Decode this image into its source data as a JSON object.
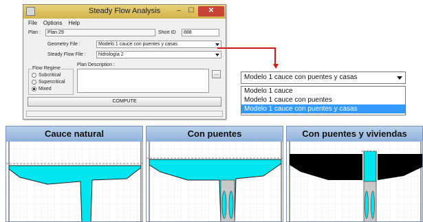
{
  "window": {
    "title": "Steady Flow Analysis",
    "minimize": "–",
    "maximize": "☐",
    "close": "✕"
  },
  "menu": [
    "File",
    "Options",
    "Help"
  ],
  "plan": {
    "label": "Plan :",
    "value": "Plan 29",
    "short_id_label": "Short ID",
    "short_id_value": "888"
  },
  "geometry": {
    "label": "Geometry File :",
    "value": "Modelo 1 cauce con puentes y casas"
  },
  "steady_flow": {
    "label": "Steady Flow File :",
    "value": "hidrología 2"
  },
  "flow_regime": {
    "label": "Flow Regime",
    "options": [
      "Subcritical",
      "Supercritical",
      "Mixed"
    ],
    "selected": "Mixed"
  },
  "plan_description": {
    "label": "Plan Description :",
    "value": "",
    "browse": "..."
  },
  "compute": {
    "label": "COMPUTE"
  },
  "callout": {
    "selected": "Modelo 1 cauce con puentes y casas",
    "options": [
      "Modelo 1 cauce",
      "Modelo 1 cauce con puentes",
      "Modelo 1 cauce con puentes y casas"
    ],
    "highlighted": "Modelo 1 cauce con puentes y casas"
  },
  "panels": [
    {
      "title": "Cauce natural"
    },
    {
      "title": "Con puentes"
    },
    {
      "title": "Con puentes y viviendas"
    }
  ],
  "colors": {
    "water": "#00e5ee",
    "structure": "#000000",
    "pier": "#c8c8c8",
    "callout": "#cc1a1a",
    "highlight": "#3399ff"
  }
}
